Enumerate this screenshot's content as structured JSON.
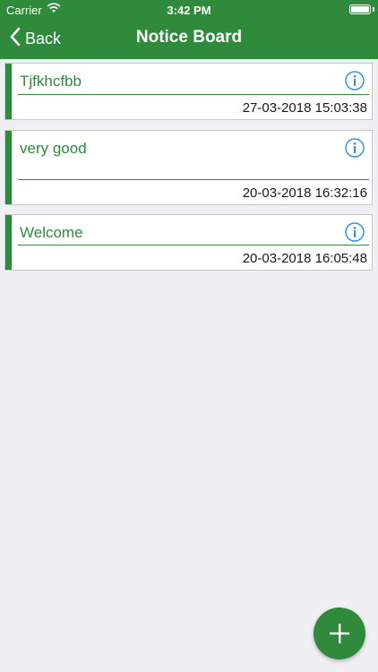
{
  "status_bar": {
    "carrier": "Carrier",
    "time": "3:42 PM"
  },
  "nav": {
    "back_label": "Back",
    "title": "Notice Board"
  },
  "notices": [
    {
      "title": "Tjfkhcfbb",
      "timestamp": "27-03-2018 15:03:38"
    },
    {
      "title": "very good",
      "timestamp": "20-03-2018 16:32:16"
    },
    {
      "title": "Welcome",
      "timestamp": "20-03-2018 16:05:48"
    }
  ],
  "icons": {
    "back": "chevron-left-icon",
    "info": "info-icon",
    "add": "plus-icon",
    "wifi": "wifi-icon",
    "battery": "battery-icon"
  },
  "colors": {
    "primary": "#2f8a3c",
    "info_blue": "#2a8fdc",
    "background": "#efeff4"
  }
}
